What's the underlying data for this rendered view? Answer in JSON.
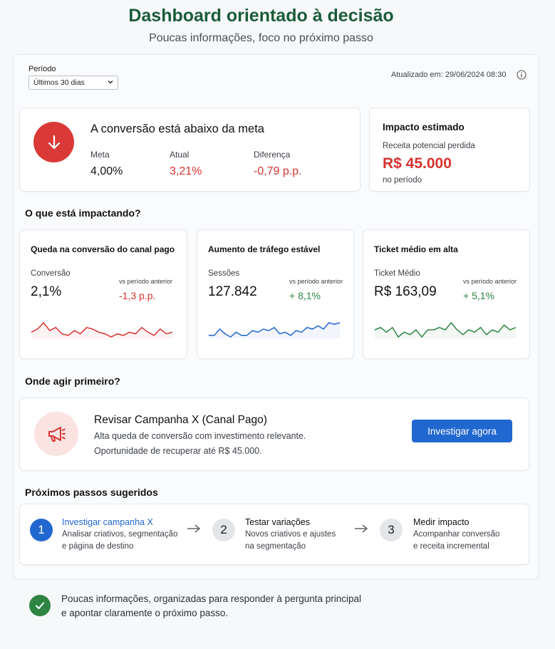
{
  "header": {
    "title": "Dashboard orientado à decisão",
    "subtitle": "Poucas informações, foco no próximo passo"
  },
  "filters": {
    "period_label": "Período",
    "period_selected": "Últimos 30 dias",
    "updated_text": "Atualizado em: 29/06/2024 08:30"
  },
  "alert": {
    "title": "A conversão está abaixo da meta",
    "icon": "arrow-down-icon",
    "metrics": [
      {
        "label": "Meta",
        "value": "4,00%"
      },
      {
        "label": "Atual",
        "value": "3,21%"
      },
      {
        "label": "Diferença",
        "value": "-0,79 p.p."
      }
    ]
  },
  "impact": {
    "title": "Impacto estimado",
    "subtitle": "Receita potencial perdida",
    "value": "R$ 45.000",
    "footer": "no período"
  },
  "sections": {
    "impacting": "O que está impactando?",
    "act_first": "Onde agir primeiro?",
    "next_steps": "Próximos passos sugeridos"
  },
  "kpis": [
    {
      "title": "Queda na conversão do canal pago",
      "label": "Conversão",
      "value": "2,1%",
      "vs": "vs período anterior",
      "delta": "-1,3 p.p.",
      "color": "#d6332f",
      "spark": [
        10,
        12,
        16,
        11,
        13,
        9,
        8,
        11,
        9,
        13,
        12,
        10,
        9,
        7,
        9,
        8,
        10,
        9,
        13,
        10,
        8,
        12,
        9,
        10
      ]
    },
    {
      "title": "Aumento de tráfego estável",
      "label": "Sessões",
      "value": "127.842",
      "vs": "vs período anterior",
      "delta": "+ 8,1%",
      "color": "#2e8543",
      "line_color": "#2167d0",
      "spark": [
        8,
        8,
        12,
        9,
        7,
        10,
        8,
        8,
        11,
        10,
        12,
        11,
        13,
        9,
        10,
        8,
        11,
        10,
        13,
        12,
        14,
        12,
        16,
        15,
        16
      ]
    },
    {
      "title": "Ticket médio em alta",
      "label": "Ticket Médio",
      "value": "R$ 163,09",
      "vs": "vs período anterior",
      "delta": "+ 5,1%",
      "color": "#2e8543",
      "line_color": "#2e8543",
      "spark": [
        11,
        12,
        10,
        12,
        8,
        10,
        9,
        11,
        8,
        11,
        11,
        12,
        11,
        14,
        11,
        9,
        11,
        10,
        12,
        9,
        11,
        10,
        13,
        11,
        12
      ]
    }
  ],
  "action": {
    "icon": "megaphone-icon",
    "title": "Revisar Campanha X (Canal Pago)",
    "line1": "Alta queda de conversão com investimento relevante.",
    "line2": "Oportunidade de recuperar até R$ 45.000.",
    "button": "Investigar agora"
  },
  "steps": [
    {
      "num": "1",
      "title": "Investigar campanha X",
      "desc1": "Analisar criativos, segmentação",
      "desc2": "e página de destino"
    },
    {
      "num": "2",
      "title": "Testar variações",
      "desc1": "Novos criativos e ajustes",
      "desc2": "na segmentação"
    },
    {
      "num": "3",
      "title": "Medir impacto",
      "desc1": "Acompanhar conversão",
      "desc2": "e receita incremental"
    }
  ],
  "footer": {
    "line1": "Poucas informações, organizadas para responder à pergunta principal",
    "line2": "e apontar claramente o próximo passo."
  }
}
